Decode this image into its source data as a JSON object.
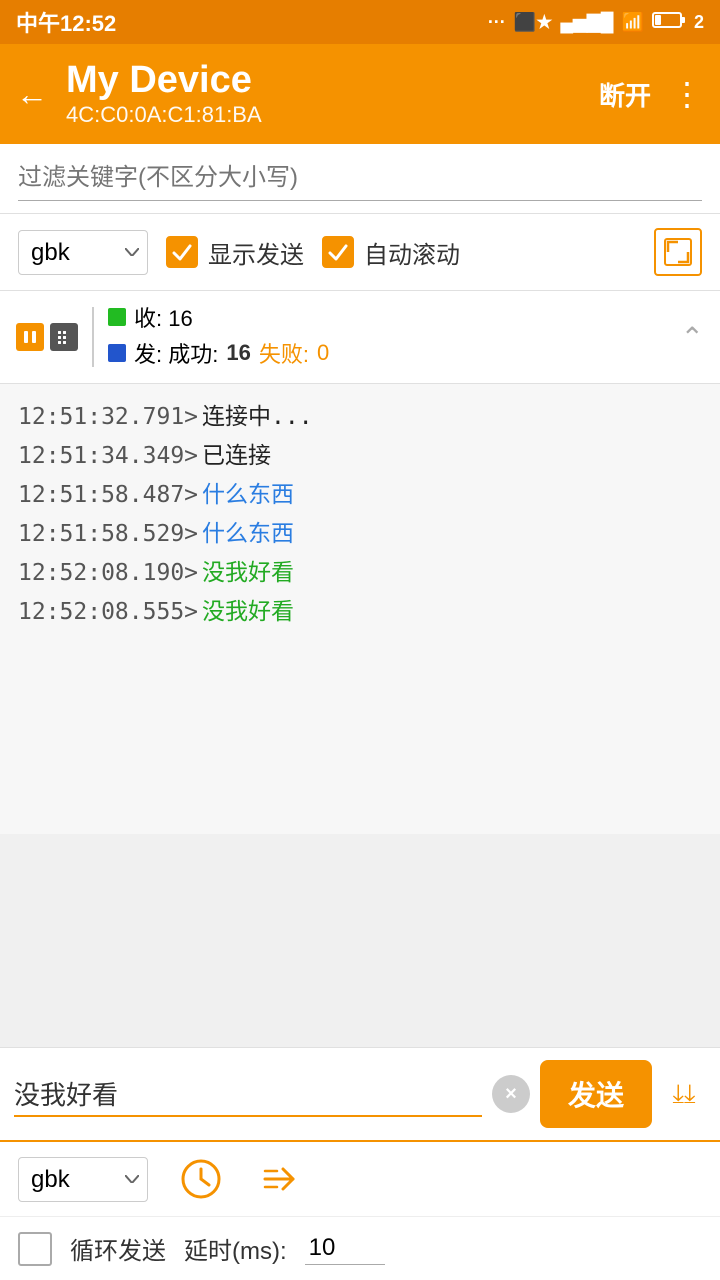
{
  "status_bar": {
    "time": "中午12:52",
    "battery": "2"
  },
  "header": {
    "title": "My Device",
    "subtitle": "4C:C0:0A:C1:81:BA",
    "disconnect_label": "断开",
    "back_icon": "←"
  },
  "filter": {
    "placeholder": "过滤关键字(不区分大小写)"
  },
  "controls": {
    "encoding": "gbk",
    "show_send_label": "显示发送",
    "auto_scroll_label": "自动滚动"
  },
  "stats": {
    "recv_label": "收: 16",
    "send_label": "发: 成功: 16 失败: 0",
    "send_success": "16",
    "send_fail": "0"
  },
  "log": {
    "entries": [
      {
        "time": "12:51:32.791>",
        "message": " 连接中...",
        "color": "normal"
      },
      {
        "time": "12:51:34.349>",
        "message": " 已连接",
        "color": "normal"
      },
      {
        "time": "12:51:58.487>",
        "message": " 什么东西",
        "color": "blue"
      },
      {
        "time": "12:51:58.529>",
        "message": " 什么东西",
        "color": "blue"
      },
      {
        "time": "12:52:08.190>",
        "message": " 没我好看",
        "color": "green"
      },
      {
        "time": "12:52:08.555>",
        "message": " 没我好看",
        "color": "green"
      }
    ]
  },
  "send_bar": {
    "input_value": "没我好看",
    "send_label": "发送",
    "clear_icon": "×"
  },
  "bottom_options": {
    "encoding": "gbk",
    "loop_label": "循环发送",
    "delay_label": "延时(ms):",
    "delay_value": "10"
  }
}
